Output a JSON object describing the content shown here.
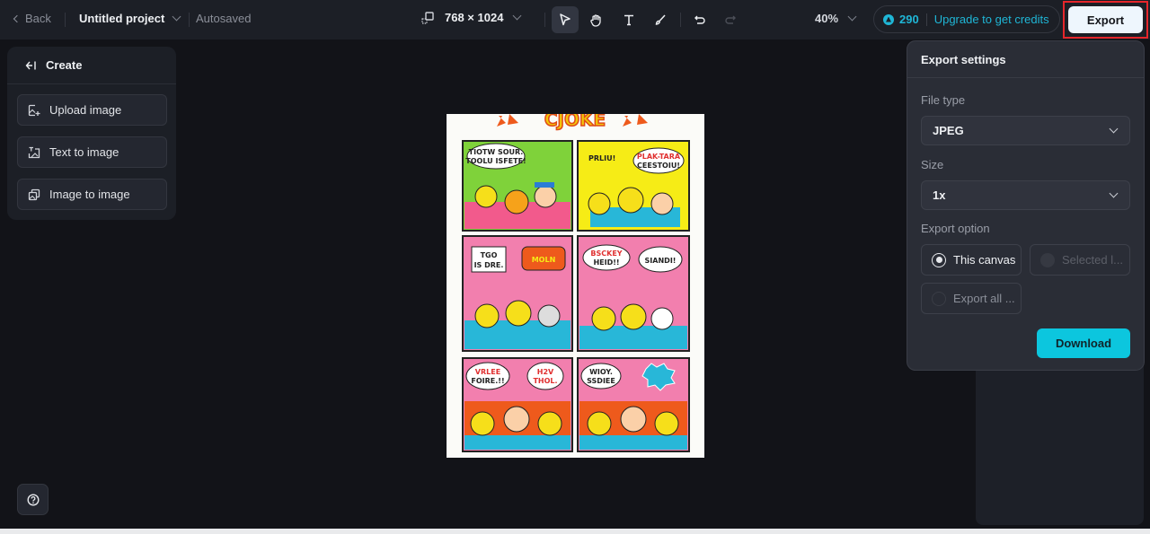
{
  "topbar": {
    "back_label": "Back",
    "project_name": "Untitled project",
    "save_status": "Autosaved",
    "canvas_size": "768 × 1024",
    "tools": [
      "select",
      "hand",
      "text",
      "brush"
    ],
    "zoom_level": "40%",
    "credits": "290",
    "upgrade_label": "Upgrade to get credits",
    "export_label": "Export"
  },
  "left_panel": {
    "title": "Create",
    "items": [
      {
        "label": "Upload image",
        "icon": "upload-image-icon"
      },
      {
        "label": "Text to image",
        "icon": "text-to-image-icon"
      },
      {
        "label": "Image to image",
        "icon": "image-to-image-icon"
      }
    ]
  },
  "canvas": {
    "description": "Comic strip image with six panels",
    "panel_texts": [
      "TIO TW SOUR. TOOLU ISFETE!",
      "PRLIU! PLAK-TARA CEESTOIU!",
      "TGO ISDRE. MOLN",
      "BSCKEY HEID!! SIANDI!",
      "VRLEE FOIRE.!! H2V THOL.",
      "WIOY. SSDIEE"
    ]
  },
  "export_settings": {
    "title": "Export settings",
    "file_type_label": "File type",
    "file_type_value": "JPEG",
    "size_label": "Size",
    "size_value": "1x",
    "export_option_label": "Export option",
    "options": [
      {
        "label": "This canvas",
        "selected": true,
        "enabled": true
      },
      {
        "label": "Selected l...",
        "selected": false,
        "enabled": false
      },
      {
        "label": "Export all ...",
        "selected": false,
        "enabled": true
      }
    ],
    "download_label": "Download"
  },
  "colors": {
    "accent": "#0cc6de",
    "credits": "#1fb6d6",
    "highlight_border": "#e5262b"
  }
}
